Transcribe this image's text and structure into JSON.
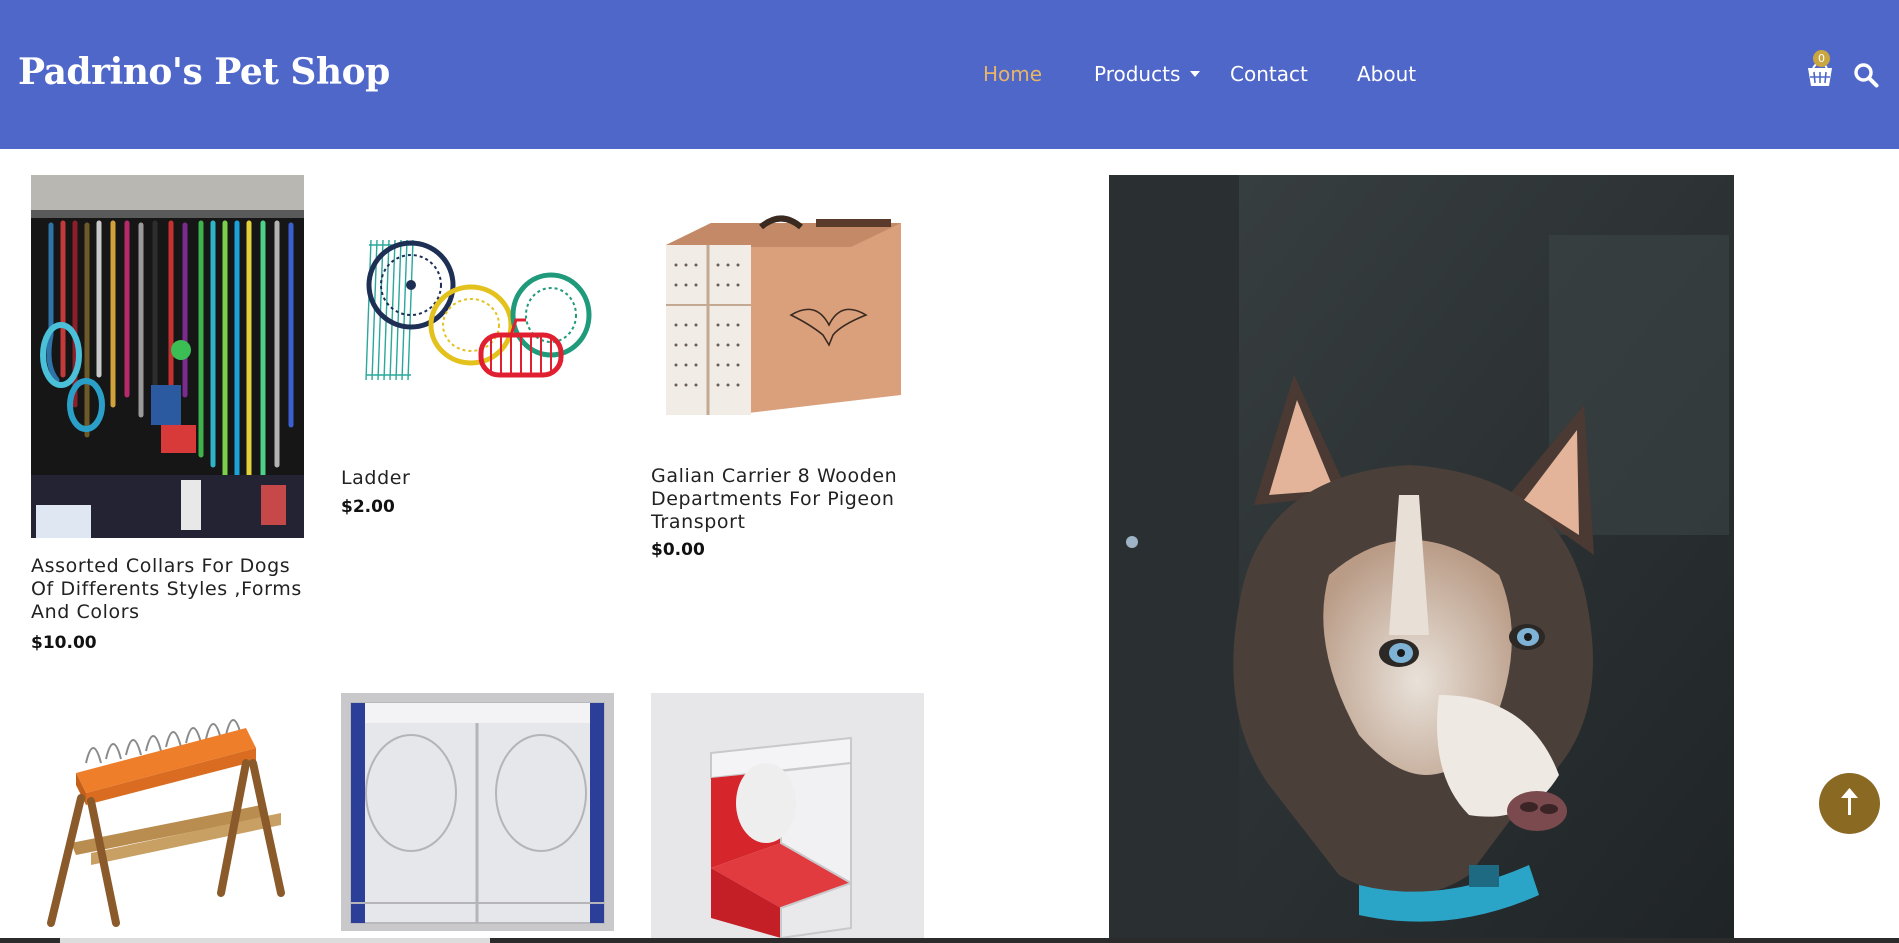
{
  "header": {
    "brand": "Padrino's Pet Shop",
    "nav": [
      {
        "label": "Home",
        "active": true
      },
      {
        "label": "Products",
        "active": false
      },
      {
        "label": "Contact",
        "active": false
      },
      {
        "label": "About",
        "active": false
      }
    ],
    "cart_count": "0",
    "icons": [
      "basket-icon",
      "search-icon",
      "chevron-down-icon"
    ],
    "accent_color": "#e7b56a",
    "header_bg": "#4f67c9"
  },
  "products": [
    {
      "name": "Assorted Collars For Dogs Of Differents Styles ,Forms And Colors",
      "price": "$10.00"
    },
    {
      "name": "Ladder",
      "price": "$2.00"
    },
    {
      "name": "Galian Carrier 8 Wooden Departments For Pigeon Transport",
      "price": "$0.00"
    },
    {
      "name": "",
      "price": ""
    },
    {
      "name": "",
      "price": ""
    },
    {
      "name": "",
      "price": ""
    }
  ],
  "scroll_top": {
    "icon": "arrow-up-icon",
    "color": "#8a6a23"
  }
}
